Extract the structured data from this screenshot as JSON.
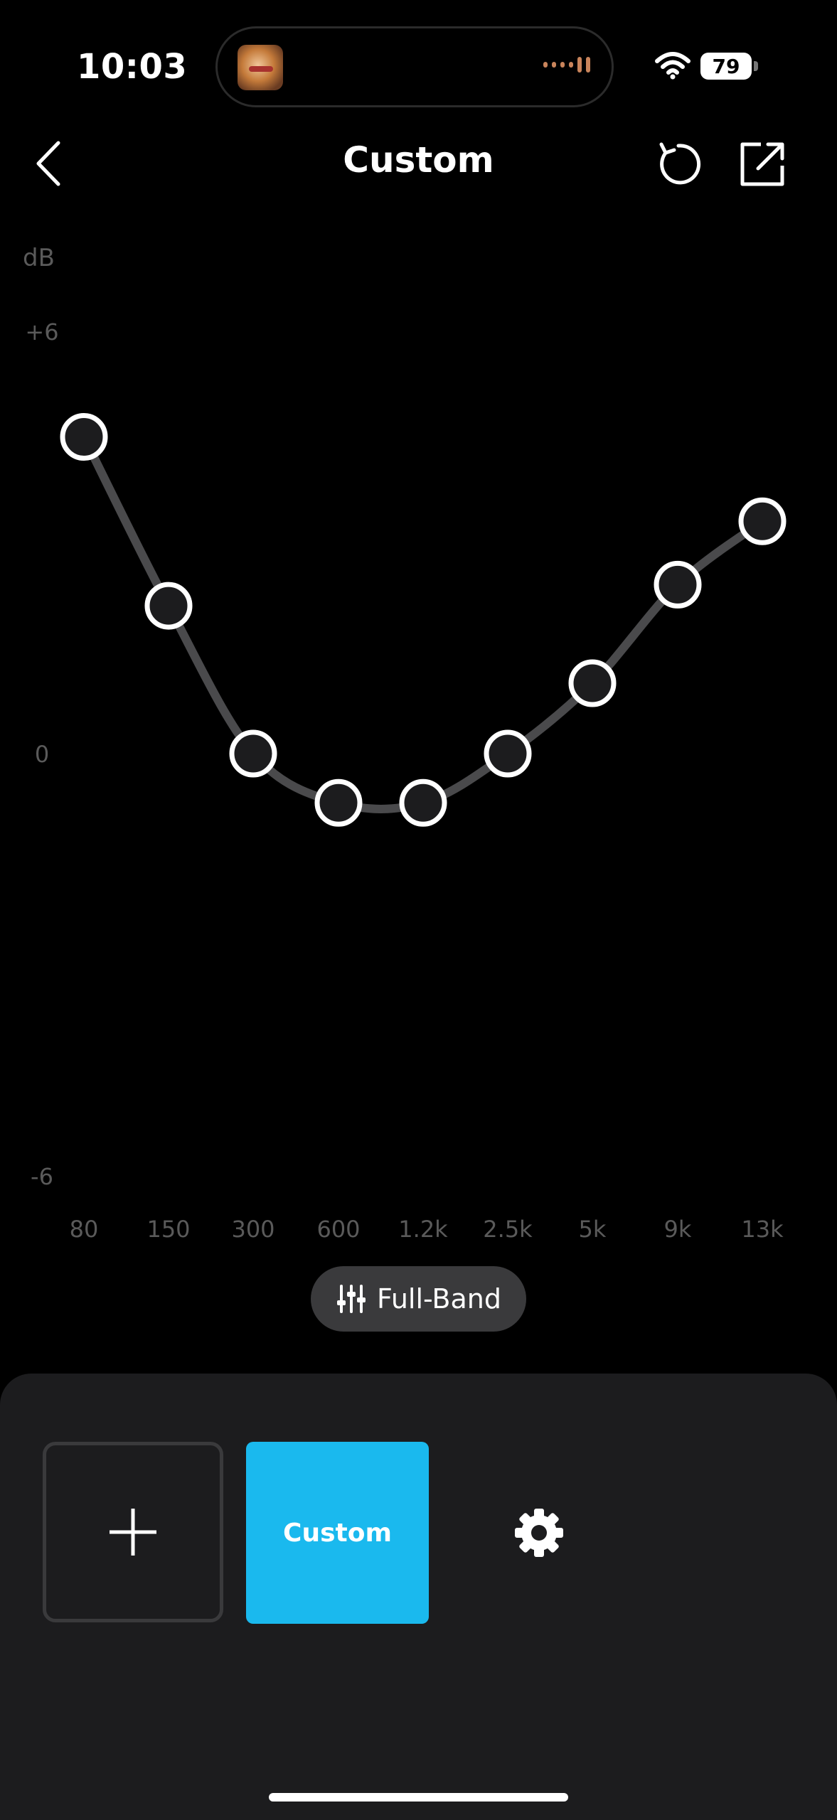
{
  "status_bar": {
    "time": "10:03",
    "battery_level": "79",
    "icons": [
      "album-art",
      "waveform-icon",
      "wifi-icon",
      "battery-icon"
    ]
  },
  "nav": {
    "title": "Custom",
    "back_icon": "chevron-left-icon",
    "reset_icon": "reset-icon",
    "share_icon": "share-icon"
  },
  "chart_data": {
    "type": "line",
    "ylabel": "dB",
    "y_ticks": [
      "+6",
      "0",
      "-6"
    ],
    "ylim": [
      -6,
      6
    ],
    "categories": [
      "80",
      "150",
      "300",
      "600",
      "1.2k",
      "2.5k",
      "5k",
      "9k",
      "13k"
    ],
    "series": [
      {
        "values": [
          4.5,
          2.1,
          0.0,
          -0.7,
          -0.7,
          0.0,
          1.0,
          2.4,
          3.3
        ]
      }
    ],
    "grid": "vertical",
    "colors": {
      "curve": "#4a4a4c",
      "node_fill": "#1c1c1e",
      "node_stroke": "#ffffff",
      "gridline": "#1e1e1e",
      "label": "#5a5a5a"
    }
  },
  "full_band": {
    "label": "Full-Band",
    "icon": "sliders-icon"
  },
  "presets": {
    "add_icon": "plus-icon",
    "items": [
      {
        "label": "Custom",
        "color": "#1ab9ee"
      }
    ],
    "settings_icon": "gear-icon"
  }
}
